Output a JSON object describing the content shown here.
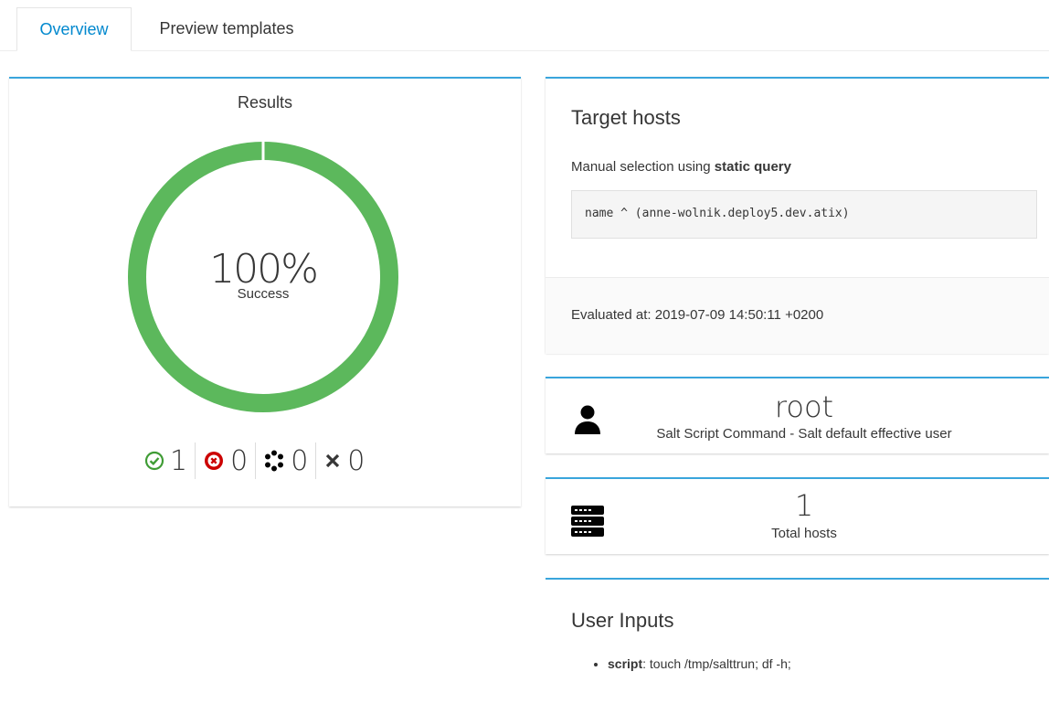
{
  "tabs": [
    {
      "label": "Overview",
      "active": true
    },
    {
      "label": "Preview templates",
      "active": false
    }
  ],
  "results": {
    "title": "Results",
    "percent": "100%",
    "percent_value": 100,
    "subtitle": "Success",
    "colors": {
      "success": "#5cb85c",
      "failed": "#cc0000",
      "pending": "#030303",
      "cancelled": "#030303"
    },
    "stats": [
      {
        "icon": "check-circle-icon",
        "value": "1"
      },
      {
        "icon": "times-circle-icon",
        "value": "0"
      },
      {
        "icon": "spinner-icon",
        "value": "0"
      },
      {
        "icon": "close-icon",
        "value": "0"
      }
    ]
  },
  "target": {
    "title": "Target hosts",
    "description_prefix": "Manual selection using ",
    "description_bold": "static query",
    "query": "name ^ (anne-wolnik.deploy5.dev.atix)",
    "evaluated": "Evaluated at: 2019-07-09 14:50:11 +0200"
  },
  "user": {
    "icon": "user-icon",
    "name": "root",
    "description": "Salt Script Command - Salt default effective user"
  },
  "hosts": {
    "icon": "server-icon",
    "count": "1",
    "label": "Total hosts"
  },
  "inputs": {
    "title": "User Inputs",
    "items": [
      {
        "key": "script",
        "value": ": touch /tmp/salttrun; df -h;"
      }
    ]
  },
  "accent": "#39a5dc",
  "link_color": "#0088ce"
}
